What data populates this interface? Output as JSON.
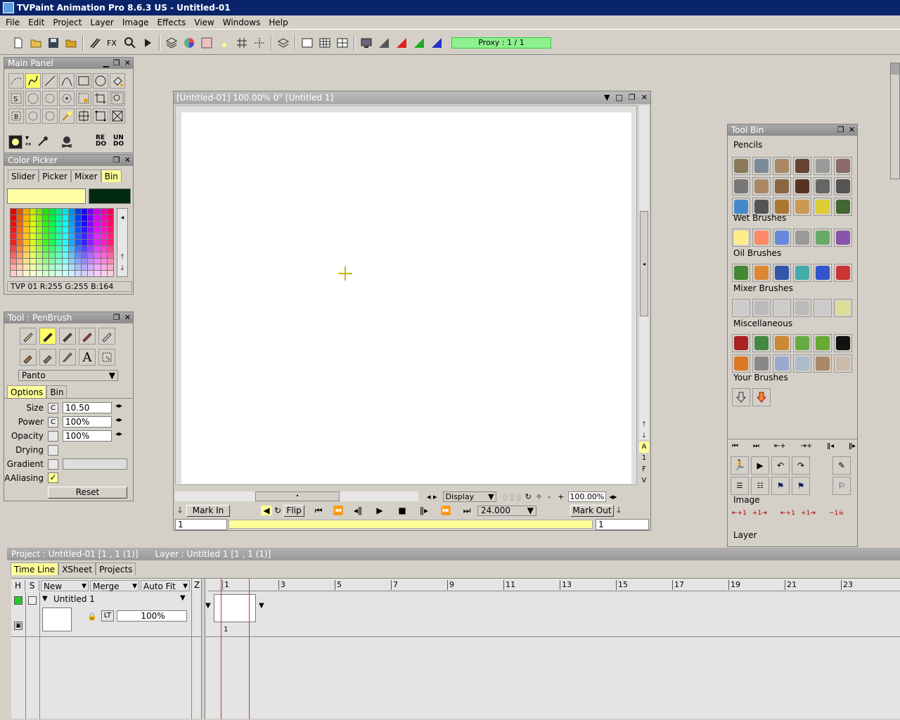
{
  "window": {
    "title": "TVPaint Animation Pro 8.6.3 US - Untitled-01"
  },
  "menu": [
    "File",
    "Edit",
    "Project",
    "Layer",
    "Image",
    "Effects",
    "View",
    "Windows",
    "Help"
  ],
  "toolbar": {
    "proxy_label": "Proxy : 1 / 1"
  },
  "main_panel": {
    "title": "Main Panel",
    "redo": "RE DO",
    "undo": "UN DO"
  },
  "color_picker": {
    "title": "Color Picker",
    "tabs": [
      "Slider",
      "Picker",
      "Mixer",
      "Bin"
    ],
    "status": "TVP 01 R:255 G:255 B:164",
    "primary_color": "#ffffa4",
    "secondary_color": "#002a10"
  },
  "tool_panel": {
    "title": "Tool : PenBrush",
    "mode_select": "Panto",
    "tabs": [
      "Options",
      "Bin"
    ],
    "rows": [
      {
        "label": "Size",
        "mode": "C",
        "value": "10.50"
      },
      {
        "label": "Power",
        "mode": "C",
        "value": "100%"
      },
      {
        "label": "Opacity",
        "mode": "",
        "value": "100%"
      }
    ],
    "drying_label": "Drying",
    "gradient_label": "Gradient",
    "aaliasing_label": "AAliasing",
    "reset_label": "Reset"
  },
  "canvas_window": {
    "title": "[Untitled-01]  100.00%   0°  [Untitled 1]",
    "display_select": "Display",
    "zoom": "100.00%",
    "mark_in": "Mark In",
    "mark_out": "Mark Out",
    "flip": "Flip",
    "fps": "24.000",
    "frame_start": "1",
    "frame_end": "1",
    "side_letters": [
      "A",
      "1",
      "F",
      "V"
    ]
  },
  "tool_bin": {
    "title": "Tool Bin",
    "sections": [
      "Pencils",
      "Wet Brushes",
      "Oil Brushes",
      "Mixer Brushes",
      "Miscellaneous",
      "Your Brushes"
    ],
    "lower_sections": [
      "Image",
      "Layer"
    ]
  },
  "project_bar": {
    "project": "Project : Untitled-01 [1 , 1  (1)]",
    "layer": "Layer : Untitled 1 [1 , 1  (1)]"
  },
  "timeline": {
    "tabs": [
      "Time Line",
      "XSheet",
      "Projects"
    ],
    "col_h": "H",
    "col_s": "S",
    "new_label": "New",
    "merge_label": "Merge",
    "autofit_label": "Auto Fit",
    "col_z": "Z",
    "ruler": [
      "1",
      "3",
      "5",
      "7",
      "9",
      "11",
      "13",
      "15",
      "17",
      "19",
      "21",
      "23"
    ],
    "layer_name": "Untitled 1",
    "layer_mode": "LT",
    "layer_opacity": "100%",
    "frame_number": "1"
  }
}
